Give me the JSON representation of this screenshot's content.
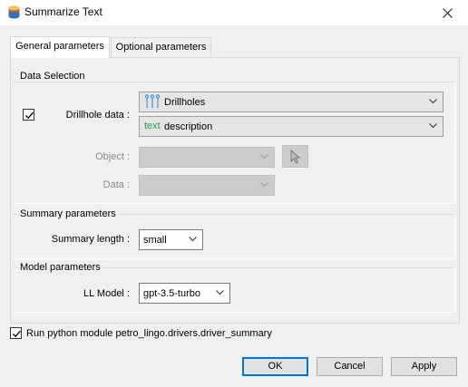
{
  "window": {
    "title": "Summarize Text",
    "close_icon": "close-icon"
  },
  "tabs": [
    {
      "label": "General parameters",
      "active": true
    },
    {
      "label": "Optional parameters",
      "active": false
    }
  ],
  "data_selection": {
    "title": "Data Selection",
    "drillhole_label": "Drillhole data :",
    "drillhole_checked": true,
    "drillhole_value": "Drillholes",
    "drillhole_icon": "drillholes-icon",
    "column_prefix": "text",
    "column_value": "description",
    "object_label": "Object :",
    "object_value": "",
    "data_label": "Data :",
    "data_value": ""
  },
  "summary": {
    "title": "Summary parameters",
    "length_label": "Summary length :",
    "length_value": "small"
  },
  "model": {
    "title": "Model parameters",
    "llm_label": "LL Model :",
    "llm_value": "gpt-3.5-turbo"
  },
  "run_module": {
    "checked": true,
    "label": "Run python module petro_lingo.drivers.driver_summary"
  },
  "buttons": {
    "ok": "OK",
    "cancel": "Cancel",
    "apply": "Apply"
  },
  "colors": {
    "accent": "#0078d7",
    "text_prefix": "#2e9b4a",
    "drillhole_icon": "#4a90d9"
  }
}
